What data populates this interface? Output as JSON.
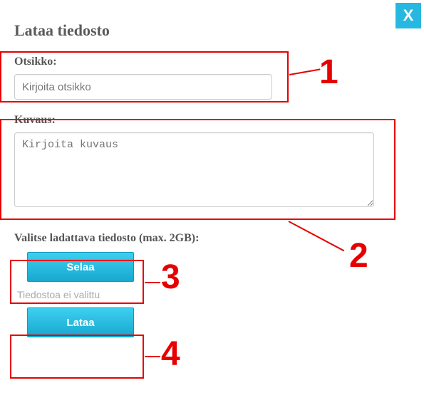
{
  "close_label": "X",
  "title": "Lataa tiedosto",
  "title_field": {
    "label": "Otsikko:",
    "placeholder": "Kirjoita otsikko"
  },
  "desc_field": {
    "label": "Kuvaus:",
    "placeholder": "Kirjoita kuvaus"
  },
  "file": {
    "label": "Valitse ladattava tiedosto (max. 2GB):",
    "browse_label": "Selaa",
    "status": "Tiedostoa ei valittu",
    "upload_label": "Lataa"
  },
  "annotations": {
    "n1": "1",
    "n2": "2",
    "n3": "3",
    "n4": "4"
  }
}
